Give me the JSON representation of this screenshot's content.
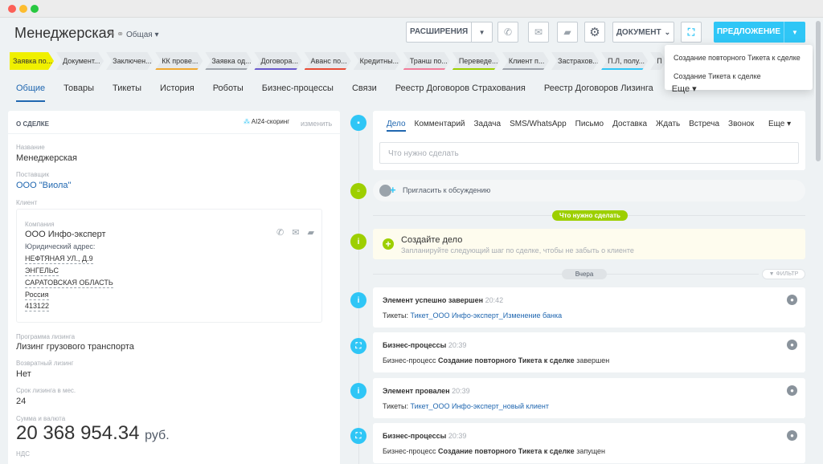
{
  "header": {
    "title": "Менеджерская",
    "category": "Общая ▾",
    "extensions_label": "РАСШИРЕНИЯ",
    "document_label": "ДОКУМЕНТ",
    "offer_label": "ПРЕДЛОЖЕНИЕ"
  },
  "stages": [
    {
      "label": "Заявка по...",
      "color": "#f0f000",
      "bar": ""
    },
    {
      "label": "Документ...",
      "color": "#e5e9ec",
      "bar": "#e5e9ec"
    },
    {
      "label": "Заключен...",
      "color": "#e5e9ec",
      "bar": "#e5e9ec"
    },
    {
      "label": "КК прове...",
      "color": "#e5e9ec",
      "bar": "#f0a830"
    },
    {
      "label": "Заявка од...",
      "color": "#e5e9ec",
      "bar": "#9da3ab"
    },
    {
      "label": "Договора...",
      "color": "#e5e9ec",
      "bar": "#6a5acd"
    },
    {
      "label": "Аванс по...",
      "color": "#e5e9ec",
      "bar": "#e94b35"
    },
    {
      "label": "Кредитны...",
      "color": "#e5e9ec",
      "bar": "#e5e9ec"
    },
    {
      "label": "Транш по...",
      "color": "#e5e9ec",
      "bar": "#f27c9a"
    },
    {
      "label": "Переведе...",
      "color": "#e5e9ec",
      "bar": "#9dcf00"
    },
    {
      "label": "Клиент п...",
      "color": "#e5e9ec",
      "bar": "#9da3ab"
    },
    {
      "label": "Застрахов...",
      "color": "#e5e9ec",
      "bar": "#e5e9ec"
    },
    {
      "label": "П.Л, полу...",
      "color": "#e5e9ec",
      "bar": "#2fc6f6"
    },
    {
      "label": "П",
      "color": "#e5e9ec",
      "bar": ""
    }
  ],
  "popup": {
    "items": [
      "Создание повторного Тикета к сделке",
      "Создание Тикета к сделке"
    ]
  },
  "tabs": [
    "Общие",
    "Товары",
    "Тикеты",
    "История",
    "Роботы",
    "Бизнес-процессы",
    "Связи",
    "Реестр Договоров Страхования",
    "Реестр Договоров Лизинга",
    "Еще ▾"
  ],
  "deal": {
    "section_title": "О СДЕЛКЕ",
    "ai_label": "AI24-скоринг",
    "change_label": "изменить",
    "name_label": "Название",
    "name_value": "Менеджерская",
    "supplier_label": "Поставщик",
    "supplier_value": "ООО \"Виола\"",
    "client_label": "Клиент",
    "company_label": "Компания",
    "company_value": "ООО Инфо-эксперт",
    "address_label": "Юридический адрес:",
    "address_lines": [
      "НЕФТЯНАЯ УЛ., Д.9",
      "ЭНГЕЛЬС",
      "САРАТОВСКАЯ ОБЛАСТЬ",
      "Россия",
      "413122"
    ],
    "program_label": "Программа лизинга",
    "program_value": "Лизинг грузового транспорта",
    "return_label": "Возвратный лизинг",
    "return_value": "Нет",
    "term_label": "Срок лизинга в мес.",
    "term_value": "24",
    "sum_label": "Сумма и валюта",
    "sum_value": "20 368 954.34",
    "sum_currency": "руб.",
    "vat_label": "НДС"
  },
  "composer": {
    "tabs": [
      "Дело",
      "Комментарий",
      "Задача",
      "SMS/WhatsApp",
      "Письмо",
      "Доставка",
      "Ждать",
      "Встреча",
      "Звонок"
    ],
    "more": "Еще ▾",
    "placeholder": "Что нужно сделать"
  },
  "timeline": {
    "invite": "Пригласить к обсуждению",
    "todo_pill": "Что нужно сделать",
    "todo_title": "Создайте дело",
    "todo_hint": "Запланируйте следующий шаг по сделке, чтобы не забыть о клиенте",
    "day_pill": "Вчера",
    "filter": "ФИЛЬТР",
    "events": [
      {
        "title": "Элемент успешно завершен",
        "time": "20:42",
        "prefix": "Тикеты:",
        "link": "Тикет_ООО Инфо-эксперт_Изменение банка",
        "bold": "",
        "suffix": ""
      },
      {
        "title": "Бизнес-процессы",
        "time": "20:39",
        "prefix": "Бизнес-процесс",
        "link": "",
        "bold": "Создание повторного Тикета к сделке",
        "suffix": "завершен"
      },
      {
        "title": "Элемент провален",
        "time": "20:39",
        "prefix": "Тикеты:",
        "link": "Тикет_ООО Инфо-эксперт_новый клиент",
        "bold": "",
        "suffix": ""
      },
      {
        "title": "Бизнес-процессы",
        "time": "20:39",
        "prefix": "Бизнес-процесс",
        "link": "",
        "bold": "Создание повторного Тикета к сделке",
        "suffix": "запущен"
      }
    ]
  }
}
